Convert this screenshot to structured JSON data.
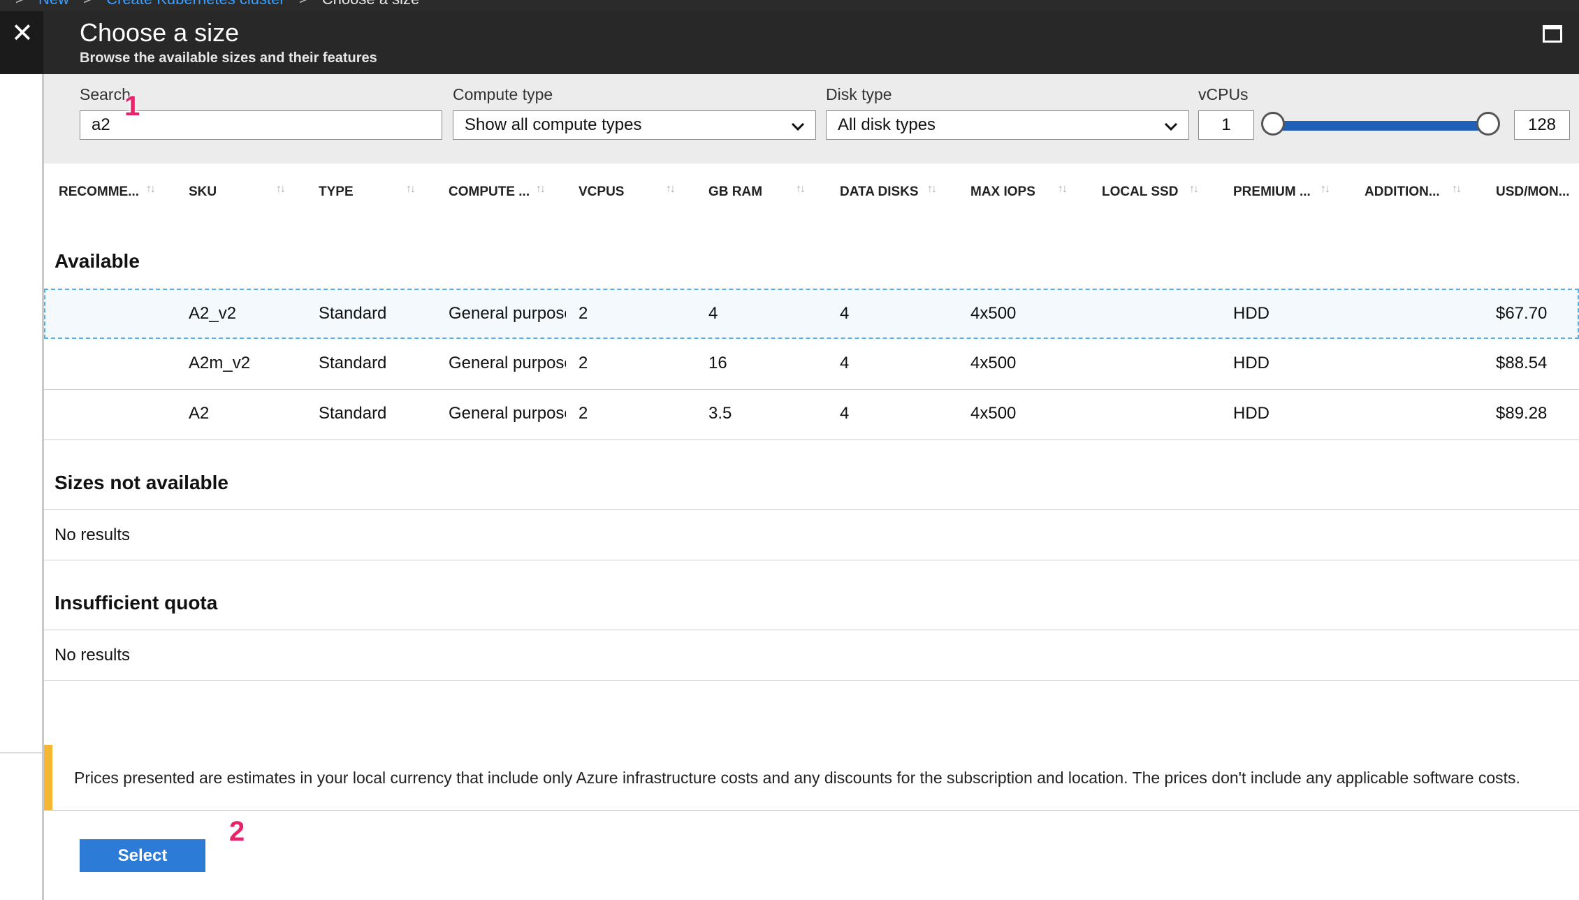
{
  "breadcrumb": {
    "items": [
      "New",
      "Create Kubernetes cluster",
      "Choose a size"
    ]
  },
  "header": {
    "title": "Choose a size",
    "subtitle": "Browse the available sizes and their features"
  },
  "filters": {
    "search": {
      "label": "Search",
      "value": "a2"
    },
    "compute_type": {
      "label": "Compute type",
      "value": "Show all compute types"
    },
    "disk_type": {
      "label": "Disk type",
      "value": "All disk types"
    },
    "vcpus": {
      "label": "vCPUs",
      "min": "1",
      "max": "128"
    }
  },
  "columns": [
    "RECOMME...",
    "SKU",
    "TYPE",
    "COMPUTE ...",
    "VCPUS",
    "GB RAM",
    "DATA DISKS",
    "MAX IOPS",
    "LOCAL SSD",
    "PREMIUM ...",
    "ADDITION...",
    "USD/MON..."
  ],
  "sections": {
    "available": "Available",
    "not_available": "Sizes not available",
    "insufficient": "Insufficient quota",
    "no_results": "No results"
  },
  "rows": [
    {
      "sku": "A2_v2",
      "type": "Standard",
      "compute": "General purpose",
      "vcpus": "2",
      "ram": "4",
      "disks": "4",
      "iops": "4x500",
      "premium": "HDD",
      "price": "$67.70"
    },
    {
      "sku": "A2m_v2",
      "type": "Standard",
      "compute": "General purpose",
      "vcpus": "2",
      "ram": "16",
      "disks": "4",
      "iops": "4x500",
      "premium": "HDD",
      "price": "$88.54"
    },
    {
      "sku": "A2",
      "type": "Standard",
      "compute": "General purpose",
      "vcpus": "2",
      "ram": "3.5",
      "disks": "4",
      "iops": "4x500",
      "premium": "HDD",
      "price": "$89.28"
    }
  ],
  "notice": "Prices presented are estimates in your local currency that include only Azure infrastructure costs and any discounts for the subscription and location. The prices don't include any applicable software costs.",
  "select_label": "Select",
  "markers": [
    "1",
    "2"
  ],
  "icons": {
    "close": "close-icon",
    "maximize": "maximize-icon",
    "chevron": "chevron-down-icon",
    "sort": "sort-icon"
  },
  "colors": {
    "accent": "#2c7bd6",
    "slider": "#2260b8",
    "warning": "#f5b731",
    "marker": "#e8246c"
  }
}
